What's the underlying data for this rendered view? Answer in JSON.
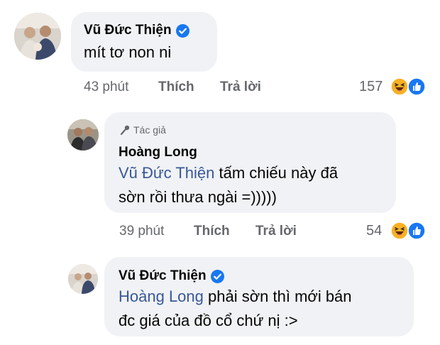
{
  "comments": [
    {
      "author": "Vũ Đức Thiện",
      "verified": true,
      "text": "mít tơ non ni",
      "time": "43 phút",
      "like_label": "Thích",
      "reply_label": "Trả lời",
      "reaction_count": "157",
      "reactions": [
        "haha-icon",
        "like-icon"
      ]
    },
    {
      "author_tag": "Tác giả",
      "author": "Hoàng Long",
      "mention": "Vũ Đức Thiện",
      "text_line1": "tấm chiếu này đã",
      "text_line2": "sờn rồi thưa ngài =)))))",
      "time": "39 phút",
      "like_label": "Thích",
      "reply_label": "Trả lời",
      "reaction_count": "54",
      "reactions": [
        "haha-icon",
        "like-icon"
      ]
    },
    {
      "author": "Vũ Đức Thiện",
      "verified": true,
      "mention": "Hoàng Long",
      "text_line1": "phải sờn thì mới bán",
      "text_line2": "đc giá của đồ cổ chứ nị :>"
    }
  ],
  "colors": {
    "bubble_bg": "#f0f2f5",
    "mention": "#385898",
    "verified": "#1877f2",
    "meta_text": "#65676b",
    "haha": "#f7b125",
    "like": "#1877f2"
  }
}
